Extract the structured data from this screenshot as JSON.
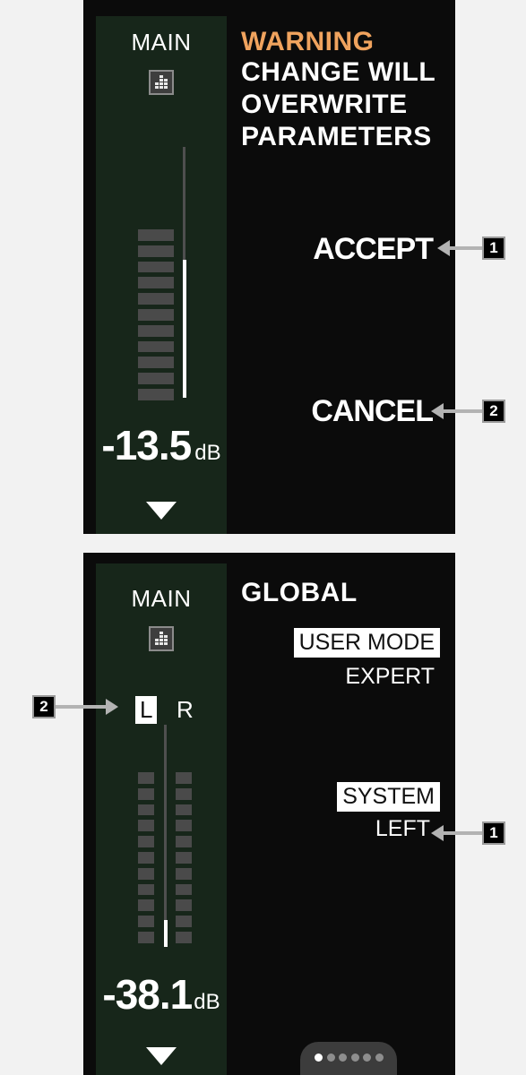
{
  "top_screen": {
    "channel_name": "MAIN",
    "level_value": "-13.5",
    "level_unit": "dB",
    "meter_level": 0.55,
    "warning_title": "WARNING",
    "warning_lines": [
      "CHANGE WILL",
      "OVERWRITE",
      "PARAMETERS"
    ],
    "accept_label": "ACCEPT",
    "cancel_label": "CANCEL",
    "callouts": [
      "1",
      "2"
    ]
  },
  "bottom_screen": {
    "channel_name": "MAIN",
    "left_label": "L",
    "right_label": "R",
    "level_value": "-38.1",
    "level_unit": "dB",
    "meter_level": 0.12,
    "section_title": "GLOBAL",
    "user_mode_label": "USER MODE",
    "user_mode_value": "EXPERT",
    "system_label": "SYSTEM",
    "system_value": "LEFT",
    "callouts": [
      "1",
      "2"
    ],
    "page_dots": {
      "count": 6,
      "active": 1
    }
  },
  "colors": {
    "accent_warning": "#f0a35e",
    "strip_background": "#17261a",
    "panel_background": "#0b0b0b"
  }
}
